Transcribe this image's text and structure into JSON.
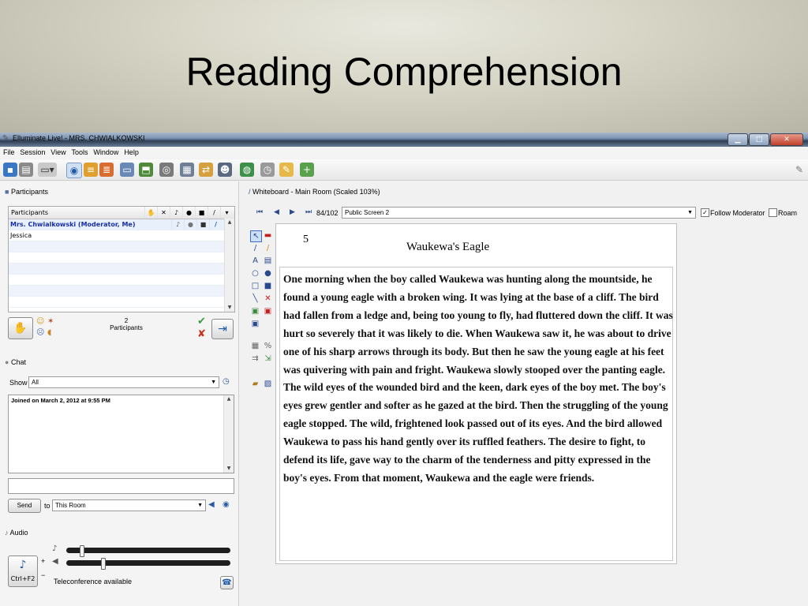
{
  "slide": {
    "title": "Reading Comprehension"
  },
  "window": {
    "title": "Elluminate Live! - MRS. CHWIALKOWSKI",
    "buttons": [
      "▁",
      "□",
      "✕"
    ]
  },
  "menu": [
    "File",
    "Session",
    "View",
    "Tools",
    "Window",
    "Help"
  ],
  "participants": {
    "section_title": "Participants",
    "header_label": "Participants",
    "rows": [
      "Mrs. Chwialkowski (Moderator, Me)",
      "Jessica"
    ],
    "count": "2",
    "count_label": "Participants"
  },
  "chat": {
    "section_title": "Chat",
    "show_label": "Show",
    "show_value": "All",
    "message": "Joined on March 2, 2012 at 9:55 PM",
    "send_label": "Send",
    "to_label": "to",
    "to_value": "This Room"
  },
  "audio": {
    "section_title": "Audio",
    "plus": "+",
    "minus": "−",
    "shortcut": "Ctrl+F2",
    "status": "Teleconference available"
  },
  "whiteboard": {
    "title": "Whiteboard - Main Room (Scaled 103%)",
    "page": "84/102",
    "screen": "Public Screen 2",
    "follow_label": "Follow Moderator",
    "follow_checked": true,
    "roam_label": "Roam",
    "roam_checked": false,
    "page_number": "5",
    "heading": "Waukewa's Eagle",
    "story": "One morning when the boy called Waukewa was hunting along the mountside, he found a young eagle with a broken wing.  It was lying at the base of a cliff.  The bird had fallen from a ledge and, being too young to fly, had fluttered down the cliff.  It was hurt so severely that it was likely to die.  When Waukewa saw it, he was about to drive one of his sharp arrows through its body.  But then he saw the young eagle at his feet was quivering with pain and fright.  Waukewa slowly stooped over the panting eagle.  The wild eyes of the wounded bird and the keen, dark eyes of the boy met.  The boy's eyes grew gentler and softer as he gazed at the bird.  Then the struggling of the young eagle stopped.  The wild, frightened look passed out of its eyes.  And the bird allowed Waukewa to pass his hand gently over its ruffled feathers.  The desire to fight, to defend its life, gave way to the charm of the tenderness and pitty expressed in the boy's eyes.  From that moment, Waukewa and the eagle were friends."
  },
  "colors": {
    "accent": "#1d5aa6",
    "moderator": "#1a2fa6",
    "titlebar": "#2e3d52"
  }
}
